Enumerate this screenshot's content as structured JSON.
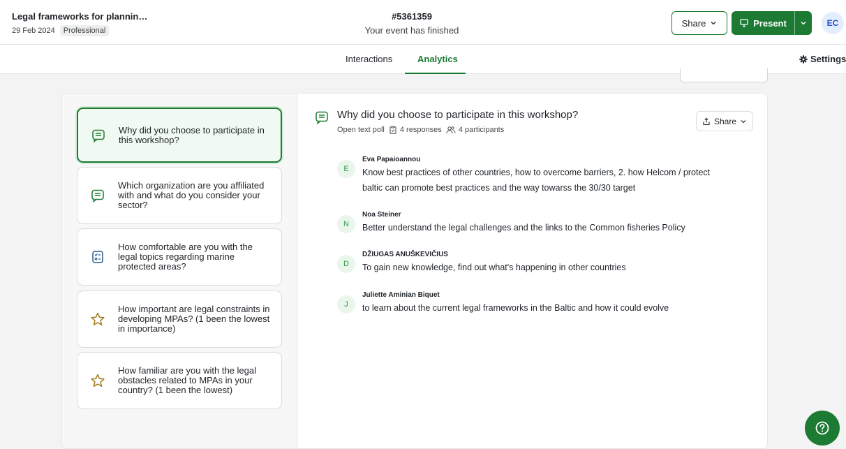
{
  "header": {
    "event_title": "Legal frameworks for plannin…",
    "event_date": "29 Feb 2024",
    "plan_badge": "Professional",
    "event_code": "#5361359",
    "event_status": "Your event has finished",
    "share_label": "Share",
    "present_label": "Present",
    "avatar_initials": "EC"
  },
  "tabs": [
    {
      "label": "Interactions",
      "active": false
    },
    {
      "label": "Analytics",
      "active": true
    }
  ],
  "settings_label": "Settings",
  "polls": [
    {
      "question": "Why did you choose to participate in this workshop?",
      "icon": "chat-icon",
      "active": true
    },
    {
      "question": "Which organization are you affiliated with and what do you consider your sector?",
      "icon": "chat-icon",
      "active": false
    },
    {
      "question": "How comfortable are you with the legal topics regarding marine protected areas?",
      "icon": "multiple-choice-icon",
      "active": false
    },
    {
      "question": "How important are legal constraints in developing MPAs? (1 been the lowest in importance)",
      "icon": "star-icon",
      "active": false
    },
    {
      "question": "How familiar are you with the legal obstacles related to MPAs in your country? (1 been the lowest)",
      "icon": "star-icon",
      "active": false
    }
  ],
  "detail": {
    "title": "Why did you choose to participate in this workshop?",
    "poll_type": "Open text poll",
    "responses": "4 responses",
    "participants": "4 participants",
    "share_label": "Share"
  },
  "responses": [
    {
      "initial": "E",
      "name": "Eva Papaioannou",
      "text": "Know best practices of other countries, how to overcome barriers, 2. how Helcom / protect baltic can promote best practices and the way towarss the 30/30 target"
    },
    {
      "initial": "N",
      "name": "Noa Steiner",
      "text": "Better understand the legal challenges and the links to the Common fisheries Policy"
    },
    {
      "initial": "D",
      "name": "DŽIUGAS ANUŠKEVIČIUS",
      "text": "To gain new knowledge, find out what's happening in other countries"
    },
    {
      "initial": "J",
      "name": "Juliette Aminian Biquet",
      "text": "to learn about the current legal frameworks in the Baltic and how it could evolve"
    }
  ],
  "colors": {
    "accent": "#1c7a32",
    "star": "#a07a18"
  }
}
